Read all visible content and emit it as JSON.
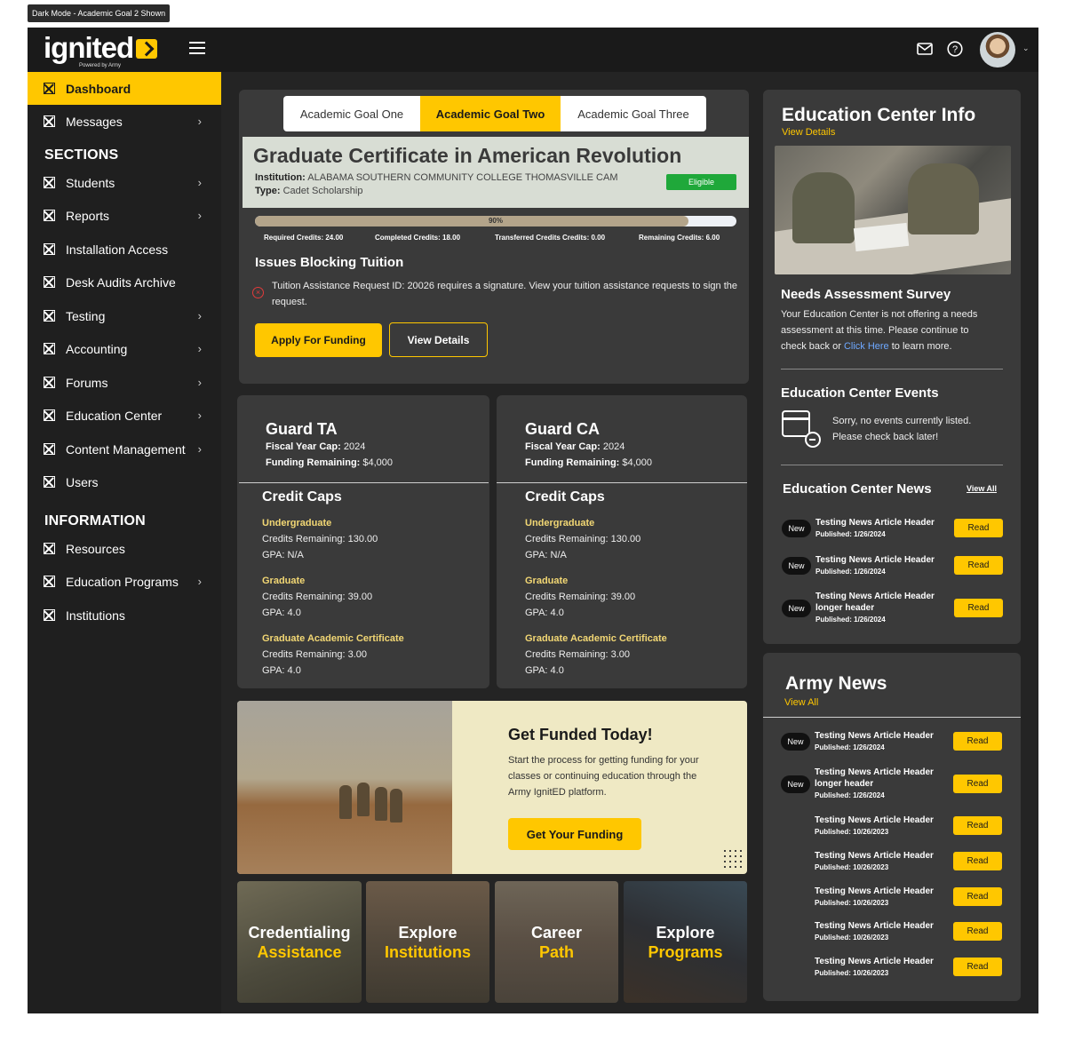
{
  "frame_label": "Dark Mode - Academic Goal 2 Shown",
  "brand": {
    "name": "ignited",
    "tagline": "Powered by Army",
    "accent": "#ffc700"
  },
  "sidebar": {
    "items": [
      {
        "label": "Dashboard",
        "active": true
      },
      {
        "label": "Messages",
        "arrow": true
      }
    ],
    "sections": [
      {
        "title": "SECTIONS",
        "items": [
          {
            "label": "Students",
            "arrow": true
          },
          {
            "label": "Reports",
            "arrow": true
          },
          {
            "label": "Installation Access",
            "arrow": false
          },
          {
            "label": "Desk Audits Archive",
            "arrow": false
          },
          {
            "label": "Testing",
            "arrow": true
          },
          {
            "label": "Accounting",
            "arrow": true
          },
          {
            "label": "Forums",
            "arrow": true
          },
          {
            "label": "Education Center",
            "arrow": true
          },
          {
            "label": "Content Management",
            "arrow": true
          },
          {
            "label": "Users",
            "arrow": false
          }
        ]
      },
      {
        "title": "INFORMATION",
        "items": [
          {
            "label": "Resources",
            "arrow": false
          },
          {
            "label": "Education Programs",
            "arrow": true
          },
          {
            "label": "Institutions",
            "arrow": false
          }
        ]
      }
    ]
  },
  "goal_tabs": [
    {
      "label": "Academic Goal One",
      "active": false
    },
    {
      "label": "Academic Goal Two",
      "active": true
    },
    {
      "label": "Academic Goal Three",
      "active": false
    }
  ],
  "goal": {
    "title": "Graduate Certificate in American Revolution",
    "institution_label": "Institution:",
    "institution": "ALABAMA SOUTHERN COMMUNITY COLLEGE THOMASVILLE CAM",
    "type_label": "Type:",
    "type": "Cadet Scholarship",
    "status": "Eligible",
    "status_color": "#1fa83a",
    "progress_pct": 90,
    "progress_label": "90%",
    "credits": {
      "required": "Required Credits: 24.00",
      "completed": "Completed Credits: 18.00",
      "transferred": "Transferred Credits Credits: 0.00",
      "remaining": "Remaining Credits: 6.00"
    },
    "issues_title": "Issues Blocking Tuition",
    "issue_text": "Tuition Assistance Request ID: 20026 requires a signature. View your tuition assistance requests to sign the request.",
    "apply_label": "Apply For Funding",
    "details_label": "View Details"
  },
  "funding": [
    {
      "title": "Guard TA",
      "fiscal_label": "Fiscal Year Cap:",
      "fiscal": "2024",
      "remaining_label": "Funding Remaining:",
      "remaining": "$4,000",
      "caps_title": "Credit Caps",
      "caps": [
        {
          "name": "Undergraduate",
          "credits": "Credits Remaining: 130.00",
          "gpa": "GPA: N/A"
        },
        {
          "name": "Graduate",
          "credits": "Credits Remaining: 39.00",
          "gpa": "GPA: 4.0"
        },
        {
          "name": "Graduate Academic Certificate",
          "credits": "Credits Remaining: 3.00",
          "gpa": "GPA: 4.0"
        }
      ]
    },
    {
      "title": "Guard CA",
      "fiscal_label": "Fiscal Year Cap:",
      "fiscal": "2024",
      "remaining_label": "Funding Remaining:",
      "remaining": "$4,000",
      "caps_title": "Credit Caps",
      "caps": [
        {
          "name": "Undergraduate",
          "credits": "Credits Remaining: 130.00",
          "gpa": "GPA: N/A"
        },
        {
          "name": "Graduate",
          "credits": "Credits Remaining: 39.00",
          "gpa": "GPA: 4.0"
        },
        {
          "name": "Graduate Academic Certificate",
          "credits": "Credits Remaining: 3.00",
          "gpa": "GPA: 4.0"
        }
      ]
    }
  ],
  "promo": {
    "title": "Get Funded Today!",
    "body": "Start the process for getting funding for your classes or continuing education through the Army IgnitED platform.",
    "button": "Get Your Funding"
  },
  "tiles": [
    {
      "line1": "Credentialing",
      "line2": "Assistance"
    },
    {
      "line1": "Explore",
      "line2": "Institutions"
    },
    {
      "line1": "Career",
      "line2": "Path"
    },
    {
      "line1": "Explore",
      "line2": "Programs"
    }
  ],
  "education_center": {
    "title": "Education Center Info",
    "view_details": "View Details",
    "survey_title": "Needs Assessment Survey",
    "survey_text_1": "Your Education Center is not offering a needs assessment at this time. Please continue to check back or",
    "survey_link": "Click Here",
    "survey_text_2": "to learn more.",
    "events_title": "Education Center Events",
    "events_text": "Sorry, no events currently listed. Please check back later!",
    "news_title": "Education Center News",
    "news_view_all": "View All",
    "news": [
      {
        "badge": "New",
        "title": "Testing News Article Header",
        "date": "Published: 1/26/2024",
        "read": "Read"
      },
      {
        "badge": "New",
        "title": "Testing News Article Header",
        "date": "Published: 1/26/2024",
        "read": "Read"
      },
      {
        "badge": "New",
        "title": "Testing News Article Header",
        "title2": "longer header",
        "date": "Published: 1/26/2024",
        "read": "Read"
      }
    ]
  },
  "army_news": {
    "title": "Army News",
    "view_all": "View All",
    "items": [
      {
        "badge": "New",
        "title": "Testing News Article Header",
        "date": "Published: 1/26/2024",
        "read": "Read"
      },
      {
        "badge": "New",
        "title": "Testing News Article Header",
        "title2": "longer header",
        "date": "Published: 1/26/2024",
        "read": "Read"
      },
      {
        "title": "Testing News Article Header",
        "date": "Published: 10/26/2023",
        "read": "Read"
      },
      {
        "title": "Testing News Article Header",
        "date": "Published: 10/26/2023",
        "read": "Read"
      },
      {
        "title": "Testing News Article Header",
        "date": "Published: 10/26/2023",
        "read": "Read"
      },
      {
        "title": "Testing News Article Header",
        "date": "Published: 10/26/2023",
        "read": "Read"
      },
      {
        "title": "Testing News Article Header",
        "date": "Published: 10/26/2023",
        "read": "Read"
      }
    ]
  },
  "icons": {
    "menu": "hamburger-icon",
    "mail": "mail-icon",
    "help": "help-icon",
    "nav": "square-x-icon"
  }
}
